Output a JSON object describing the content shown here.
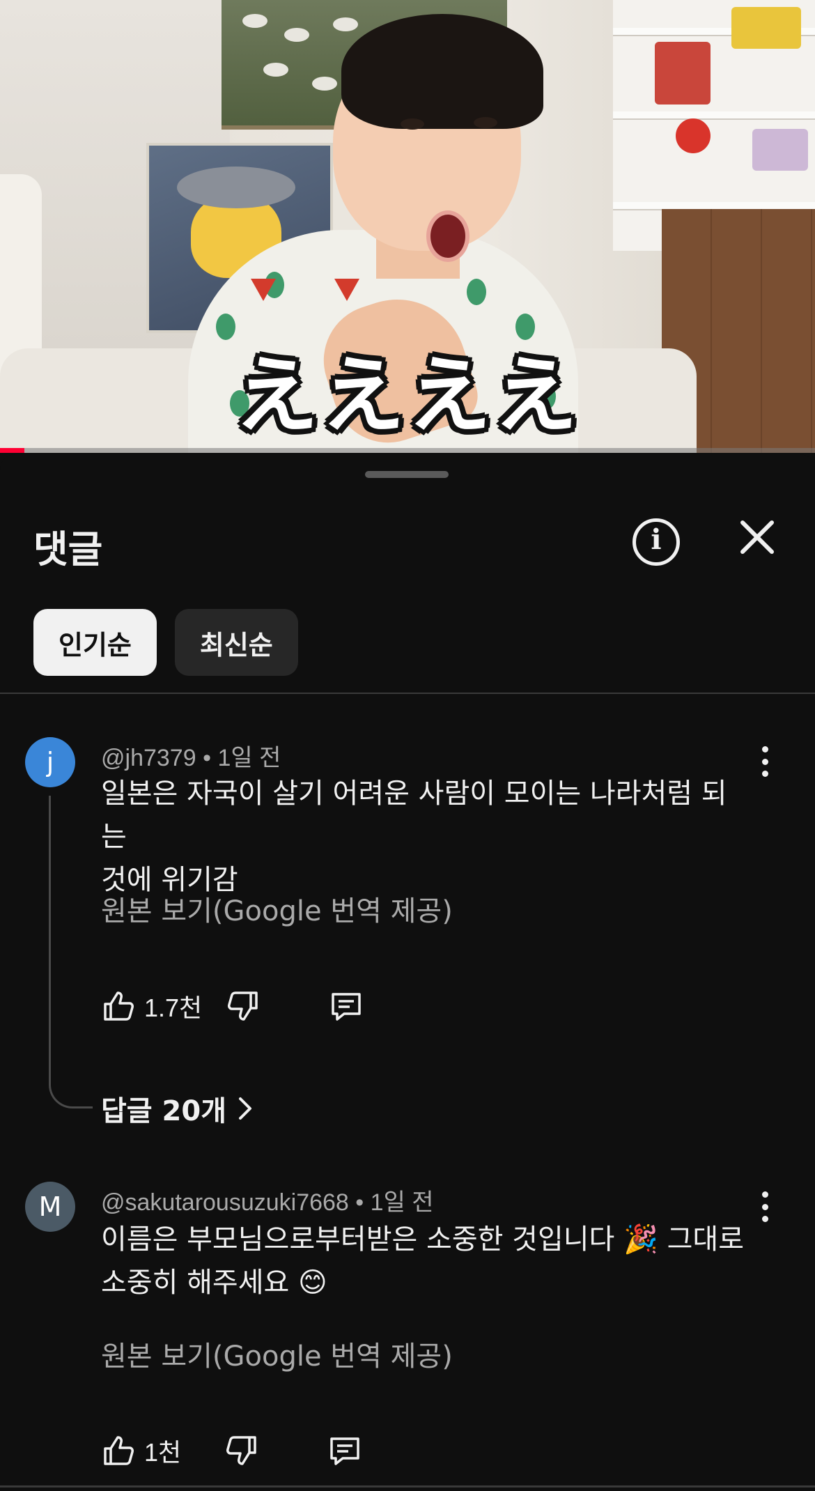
{
  "video": {
    "caption": "ええええ",
    "progress_fraction": 0.03
  },
  "panel": {
    "title": "댓글"
  },
  "sort_chips": [
    {
      "label": "인기순",
      "active": true
    },
    {
      "label": "최신순",
      "active": false
    }
  ],
  "comments": [
    {
      "avatar_letter": "j",
      "avatar_color": "#3a86d8",
      "author": "@jh7379",
      "time": "1일 전",
      "text_line1": "일본은 자국이 살기 어려운 사람이 모이는 나라처럼 되는",
      "text_line2": "것에 위기감",
      "translate_label": "원본 보기(Google 번역 제공)",
      "likes": "1.7천",
      "replies_label": "답글 20개"
    },
    {
      "avatar_letter": "M",
      "avatar_color": "#4b5a66",
      "author": "@sakutarousuzuki7668",
      "time": "1일 전",
      "text_line1": "이름은 부모님으로부터받은 소중한 것입니다",
      "text_emoji1": "🎉",
      "text_line1_tail": "그대로",
      "text_line2": "소중히 해주세요",
      "text_emoji2": "😊",
      "translate_label": "원본 보기(Google 번역 제공)",
      "likes": "1천"
    }
  ],
  "separator": "•",
  "icons": {
    "info": "info-icon",
    "close": "close-icon",
    "like": "thumbs-up-icon",
    "dislike": "thumbs-down-icon",
    "reply": "comment-icon",
    "more": "more-vertical-icon",
    "chevron": "chevron-right-icon"
  }
}
